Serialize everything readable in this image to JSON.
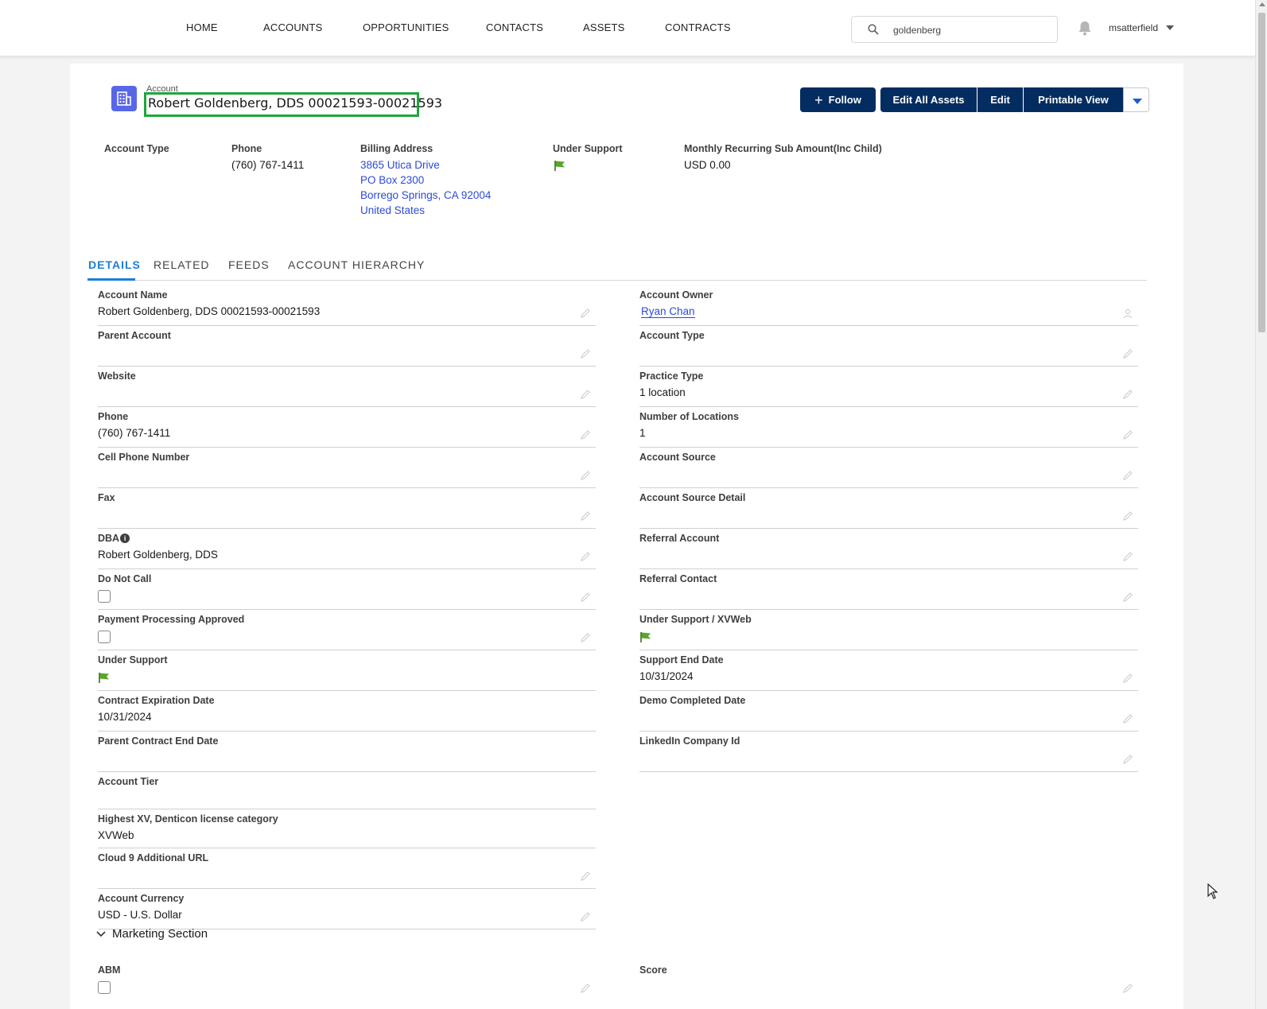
{
  "nav": {
    "items": [
      "HOME",
      "ACCOUNTS",
      "OPPORTUNITIES",
      "CONTACTS",
      "ASSETS",
      "CONTRACTS"
    ],
    "search_value": "goldenberg",
    "user": "msatterfield"
  },
  "record": {
    "object_label": "Account",
    "title": "Robert Goldenberg, DDS 00021593-00021593"
  },
  "actions": {
    "follow": "Follow",
    "edit_all_assets": "Edit All Assets",
    "edit": "Edit",
    "printable_view": "Printable View"
  },
  "highlights": {
    "account_type_label": "Account Type",
    "phone_label": "Phone",
    "phone_value": "(760) 767-1411",
    "billing_label": "Billing Address",
    "billing_lines": [
      "3865 Utica Drive",
      "PO Box 2300",
      "Borrego Springs, CA 92004",
      "United States"
    ],
    "under_support_label": "Under Support",
    "mrr_label": "Monthly Recurring Sub Amount(Inc Child)",
    "mrr_value": "USD 0.00"
  },
  "tabs": [
    "DETAILS",
    "RELATED",
    "FEEDS",
    "ACCOUNT HIERARCHY"
  ],
  "details": {
    "left": [
      {
        "label": "Account Name",
        "value": "Robert Goldenberg, DDS 00021593-00021593"
      },
      {
        "label": "Parent Account",
        "value": ""
      },
      {
        "label": "Website",
        "value": ""
      },
      {
        "label": "Phone",
        "value": "(760) 767-1411"
      },
      {
        "label": "Cell Phone Number",
        "value": ""
      },
      {
        "label": "Fax",
        "value": ""
      },
      {
        "label": "DBA",
        "value": "Robert Goldenberg, DDS"
      },
      {
        "label": "Do Not Call",
        "value": ""
      },
      {
        "label": "Payment Processing Approved",
        "value": ""
      },
      {
        "label": "Under Support",
        "value": ""
      },
      {
        "label": "Contract Expiration Date",
        "value": "10/31/2024"
      },
      {
        "label": "Parent Contract End Date",
        "value": ""
      },
      {
        "label": "Account Tier",
        "value": ""
      },
      {
        "label": "Highest XV, Denticon license category",
        "value": "XVWeb"
      },
      {
        "label": "Cloud 9 Additional URL",
        "value": ""
      },
      {
        "label": "Account Currency",
        "value": "USD - U.S. Dollar"
      }
    ],
    "right": [
      {
        "label": "Account Owner",
        "value": "Ryan Chan"
      },
      {
        "label": "Account Type",
        "value": ""
      },
      {
        "label": "Practice Type",
        "value": "1 location"
      },
      {
        "label": "Number of Locations",
        "value": "1"
      },
      {
        "label": "Account Source",
        "value": ""
      },
      {
        "label": "Account Source Detail",
        "value": ""
      },
      {
        "label": "Referral Account",
        "value": ""
      },
      {
        "label": "Referral Contact",
        "value": ""
      },
      {
        "label": "Under Support / XVWeb",
        "value": ""
      },
      {
        "label": "Support End Date",
        "value": "10/31/2024"
      },
      {
        "label": "Demo Completed Date",
        "value": ""
      },
      {
        "label": "LinkedIn Company Id",
        "value": ""
      }
    ]
  },
  "marketing": {
    "section_title": "Marketing Section",
    "abm_label": "ABM",
    "score_label": "Score"
  },
  "colors": {
    "brand_navy": "#032d60",
    "link_blue": "#2d4bd4",
    "tab_active": "#1c7ed6",
    "highlight_box": "#1ea63b",
    "flag_green": "#5aa626"
  }
}
